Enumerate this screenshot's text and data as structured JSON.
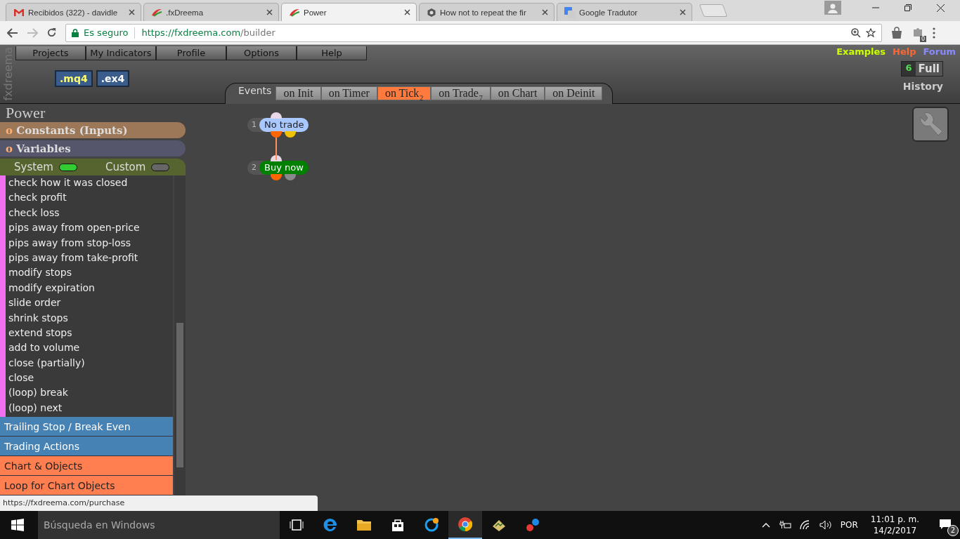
{
  "browser": {
    "tabs": [
      {
        "title": "Recibidos (322) - davidle",
        "selected": false,
        "kind": "mail"
      },
      {
        "title": ".fxDreema",
        "selected": false,
        "kind": "fx"
      },
      {
        "title": "Power",
        "selected": true,
        "kind": "fx"
      },
      {
        "title": "How not to repeat the fir",
        "selected": false,
        "kind": "hex"
      },
      {
        "title": "Google Tradutor",
        "selected": false,
        "kind": "translate"
      }
    ],
    "security": "Es seguro",
    "url_host": "https://fxdreema.com",
    "url_path": "/builder",
    "extension_badge": "0"
  },
  "app": {
    "brand": "fxdreema",
    "menu": [
      "Projects",
      "My Indicators",
      "Profile",
      "Options",
      "Help"
    ],
    "export_buttons": [
      ".mq4",
      ".ex4"
    ],
    "events_label": "Events",
    "event_tabs": [
      {
        "label": "on Init",
        "selected": false
      },
      {
        "label": "on Timer",
        "selected": false
      },
      {
        "label": "on Tick",
        "selected": true,
        "count": "2"
      },
      {
        "label": "on Trade",
        "selected": false,
        "count": "7"
      },
      {
        "label": "on Chart",
        "selected": false
      },
      {
        "label": "on Deinit",
        "selected": false
      }
    ],
    "links": [
      {
        "label": "Examples",
        "color": "#ccff00"
      },
      {
        "label": "Help",
        "color": "#ff6633"
      },
      {
        "label": "Forum",
        "color": "#8a8aff"
      }
    ],
    "history": {
      "count": "6",
      "label": "Full",
      "title": "History"
    }
  },
  "sidebar": {
    "project": "Power",
    "sections": [
      {
        "marker": "o",
        "label": "Constants (Inputs)",
        "color": "#9c7858"
      },
      {
        "marker": "o",
        "label": "Variables",
        "color": "#55556b"
      }
    ],
    "toggles": [
      {
        "label": "System",
        "on": true
      },
      {
        "label": "Custom",
        "on": false
      }
    ],
    "blocks": [
      "check how it was closed",
      "check profit",
      "check loss",
      "pips away from open-price",
      "pips away from stop-loss",
      "pips away from take-profit",
      "modify stops",
      "modify expiration",
      "slide order",
      "shrink stops",
      "extend stops",
      "add to volume",
      "close (partially)",
      "close",
      "(loop) break",
      "(loop) next"
    ],
    "categories": [
      {
        "label": "Trailing Stop / Break Even",
        "color": "#4682b4"
      },
      {
        "label": "Trading Actions",
        "color": "#4682b4"
      },
      {
        "label": "Chart & Objects",
        "color": "#ff7f50"
      },
      {
        "label": "Loop for Chart Objects",
        "color": "#ff7f50"
      }
    ]
  },
  "canvas": {
    "nodes": [
      {
        "number": "1",
        "label": "No trade",
        "color": "#a8c8ff",
        "outputs": [
          {
            "color": "#ff6600"
          },
          {
            "color": "#f2c200"
          }
        ]
      },
      {
        "number": "2",
        "label": "Buy now",
        "color": "#008000",
        "outputs": [
          {
            "color": "#ff6600"
          },
          {
            "color": "#8a8a8a"
          }
        ]
      }
    ]
  },
  "status_url": "https://fxdreema.com/purchase",
  "taskbar": {
    "search_placeholder": "Búsqueda en Windows",
    "apps": [
      {
        "kind": "taskview",
        "selected": false
      },
      {
        "kind": "edge",
        "selected": false
      },
      {
        "kind": "folder",
        "selected": false
      },
      {
        "kind": "store",
        "selected": false
      },
      {
        "kind": "sync",
        "selected": false
      },
      {
        "kind": "chrome",
        "selected": true
      },
      {
        "kind": "terminal",
        "selected": false
      },
      {
        "kind": "dots",
        "selected": false
      }
    ],
    "language": "POR",
    "time": "11:01 p. m.",
    "date": "14/2/2017",
    "notifications": "2"
  }
}
